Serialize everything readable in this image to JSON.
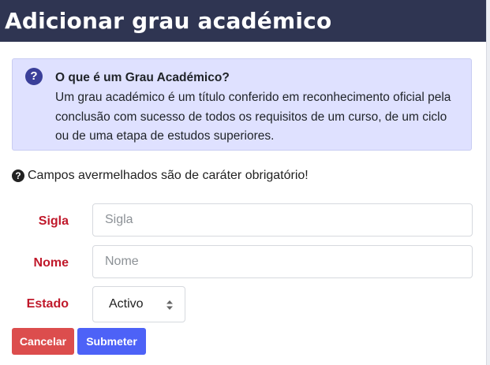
{
  "header": {
    "title": "Adicionar grau académico"
  },
  "info": {
    "icon": "question-circle-icon",
    "title": "O que é um Grau Académico?",
    "text": "Um grau académico é um título conferido em reconhecimento oficial pela conclusão com sucesso de todos os requisitos de um curso, de um ciclo ou de uma etapa de estudos superiores."
  },
  "required_note": {
    "icon": "question-circle-icon",
    "text": "Campos avermelhados são de caráter obrigatório!"
  },
  "form": {
    "sigla": {
      "label": "Sigla",
      "placeholder": "Sigla",
      "value": ""
    },
    "nome": {
      "label": "Nome",
      "placeholder": "Nome",
      "value": ""
    },
    "estado": {
      "label": "Estado",
      "value": "Activo"
    }
  },
  "buttons": {
    "cancel": "Cancelar",
    "submit": "Submeter"
  },
  "colors": {
    "header_bg": "#2f3552",
    "info_bg": "#dfe1ff",
    "required_label": "#c0192b",
    "cancel_bg": "#dc4d4d",
    "submit_bg": "#4d62f7"
  }
}
